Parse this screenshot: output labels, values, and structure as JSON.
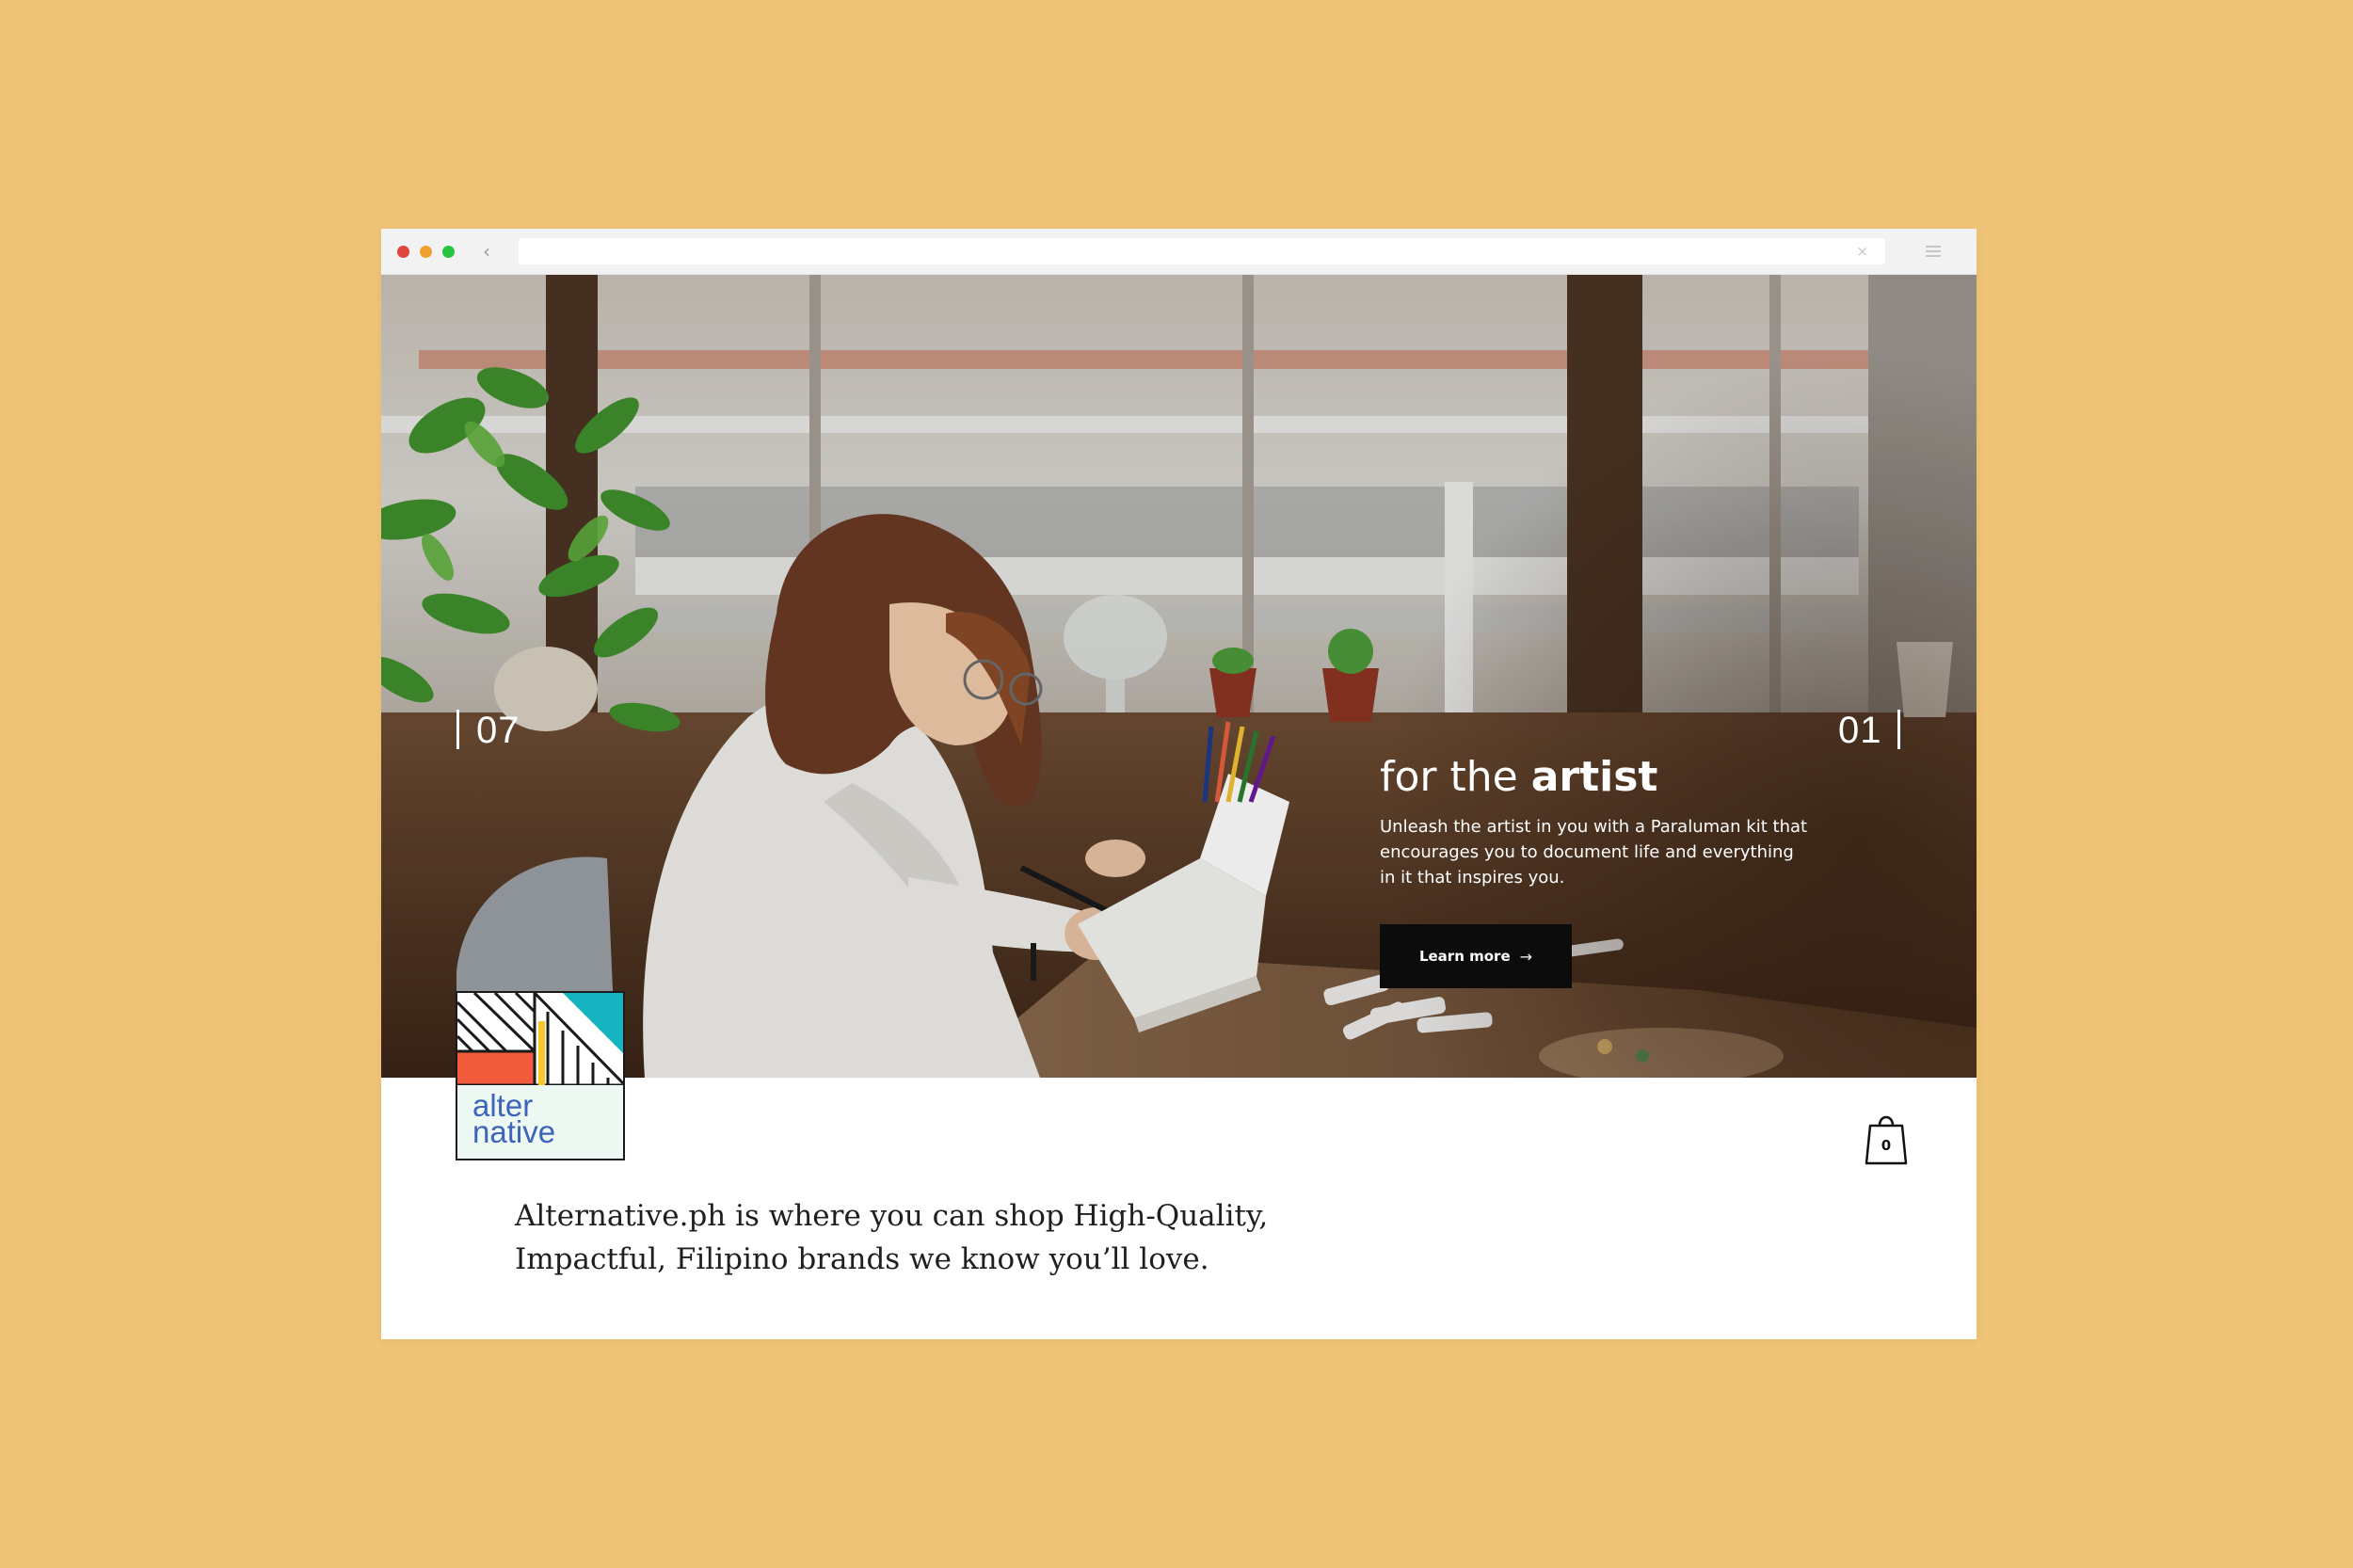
{
  "browser": {
    "window_buttons": [
      "close",
      "minimize",
      "maximize"
    ],
    "back_icon": "chevron-left-icon",
    "url": "",
    "clear_icon": "×",
    "menu_icon": "hamburger-menu-icon"
  },
  "colors": {
    "background": "#f0c477",
    "close": "#e0443e",
    "minimize": "#f0a030",
    "maximize": "#27c43f",
    "button_dark": "#0c0c0c",
    "logo_blue": "#3d63ba",
    "logo_teal": "#16b4c0",
    "logo_red": "#f15a3b",
    "logo_yellow": "#f8c728"
  },
  "hero": {
    "prev_counter": "07",
    "next_counter": "01",
    "title_prefix": "for the ",
    "title_emphasis": "artist",
    "description": "Unleash the artist in you with a Paraluman kit that encourages you to document life and everything in it that inspires you.",
    "cta_label": "Learn more",
    "cta_icon": "→"
  },
  "logo": {
    "line1": "alter",
    "line2": "native"
  },
  "cart": {
    "icon": "shopping-bag-icon",
    "count": "0"
  },
  "tagline": {
    "line1": "Alternative.ph is where you can shop High-Quality,",
    "line2": "Impactful, Filipino brands we know you’ll love."
  }
}
